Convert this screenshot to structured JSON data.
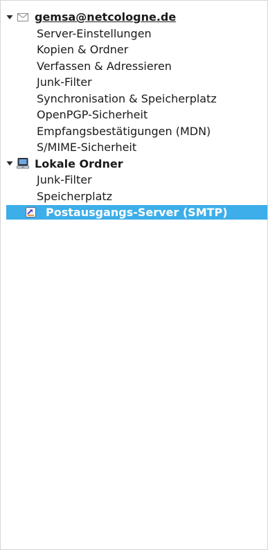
{
  "accounts": [
    {
      "name": "gemsa@netcologne.de",
      "icon": "mail-envelope-icon",
      "items": [
        "Server-Einstellungen",
        "Kopien & Ordner",
        "Verfassen & Adressieren",
        "Junk-Filter",
        "Synchronisation & Speicherplatz",
        "OpenPGP-Sicherheit",
        "Empfangsbestätigungen (MDN)",
        "S/MIME-Sicherheit"
      ]
    },
    {
      "name": "Lokale Ordner",
      "icon": "computer-icon",
      "items": [
        "Junk-Filter",
        "Speicherplatz"
      ]
    }
  ],
  "outgoing": {
    "label": "Postausgangs-Server (SMTP)",
    "icon": "smtp-server-icon",
    "selected": true
  },
  "colors": {
    "selection": "#3daee9",
    "selection_text": "#ffffff"
  }
}
